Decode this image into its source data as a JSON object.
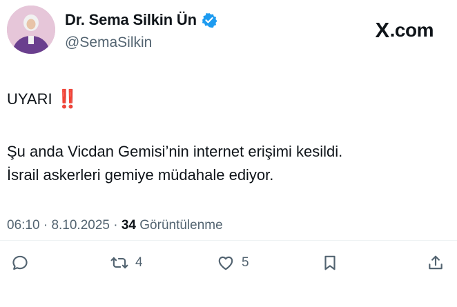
{
  "author": {
    "display_name": "Dr. Sema Silkin Ün",
    "handle": "@SemaSilkin",
    "verified": true,
    "avatar_icon": "profile-photo"
  },
  "brand": {
    "logo": "X",
    "suffix": ".com"
  },
  "tweet": {
    "warning": "UYARI",
    "warning_emoji": "‼️",
    "line1": "Şu anda Vicdan Gemisi’nin internet erişimi kesildi.",
    "line2": "İsrail askerleri gemiye müdahale ediyor."
  },
  "meta": {
    "time": "06:10",
    "separator1": "·",
    "date": "8.10.2025",
    "separator2": "·",
    "views": "34",
    "views_label": "Görüntülenme"
  },
  "actions": {
    "reply_icon": "reply-icon",
    "retweet_count": "4",
    "like_count": "5",
    "bookmark_icon": "bookmark-icon",
    "share_icon": "share-icon"
  },
  "colors": {
    "text": "#0f1419",
    "secondary": "#536471",
    "verified": "#1d9bf0",
    "warning_emoji": "#d42020"
  }
}
